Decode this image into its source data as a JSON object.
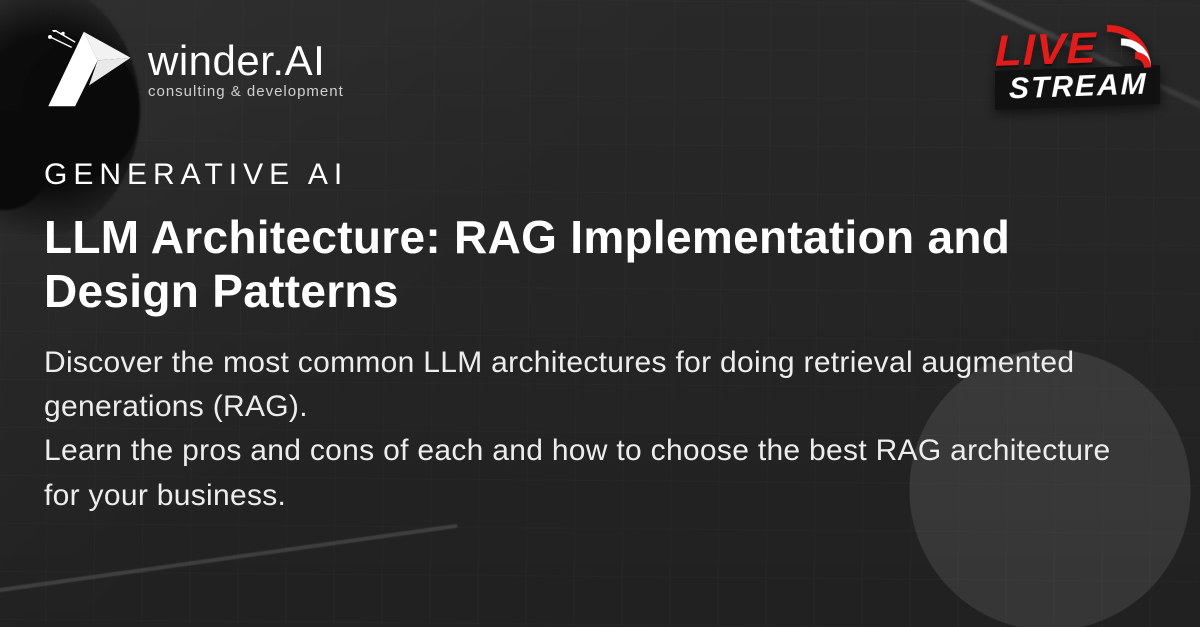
{
  "logo": {
    "name": "winder.AI",
    "tagline": "consulting & development"
  },
  "live_badge": {
    "line1": "LIVE",
    "line2": "STREAM"
  },
  "eyebrow": "GENERATIVE AI",
  "title": "LLM Architecture: RAG Implementation and Design Patterns",
  "description": "Discover the most common LLM architectures for doing retrieval augmented generations (RAG).\nLearn the pros and cons of each and how to choose the best RAG architecture for your business."
}
